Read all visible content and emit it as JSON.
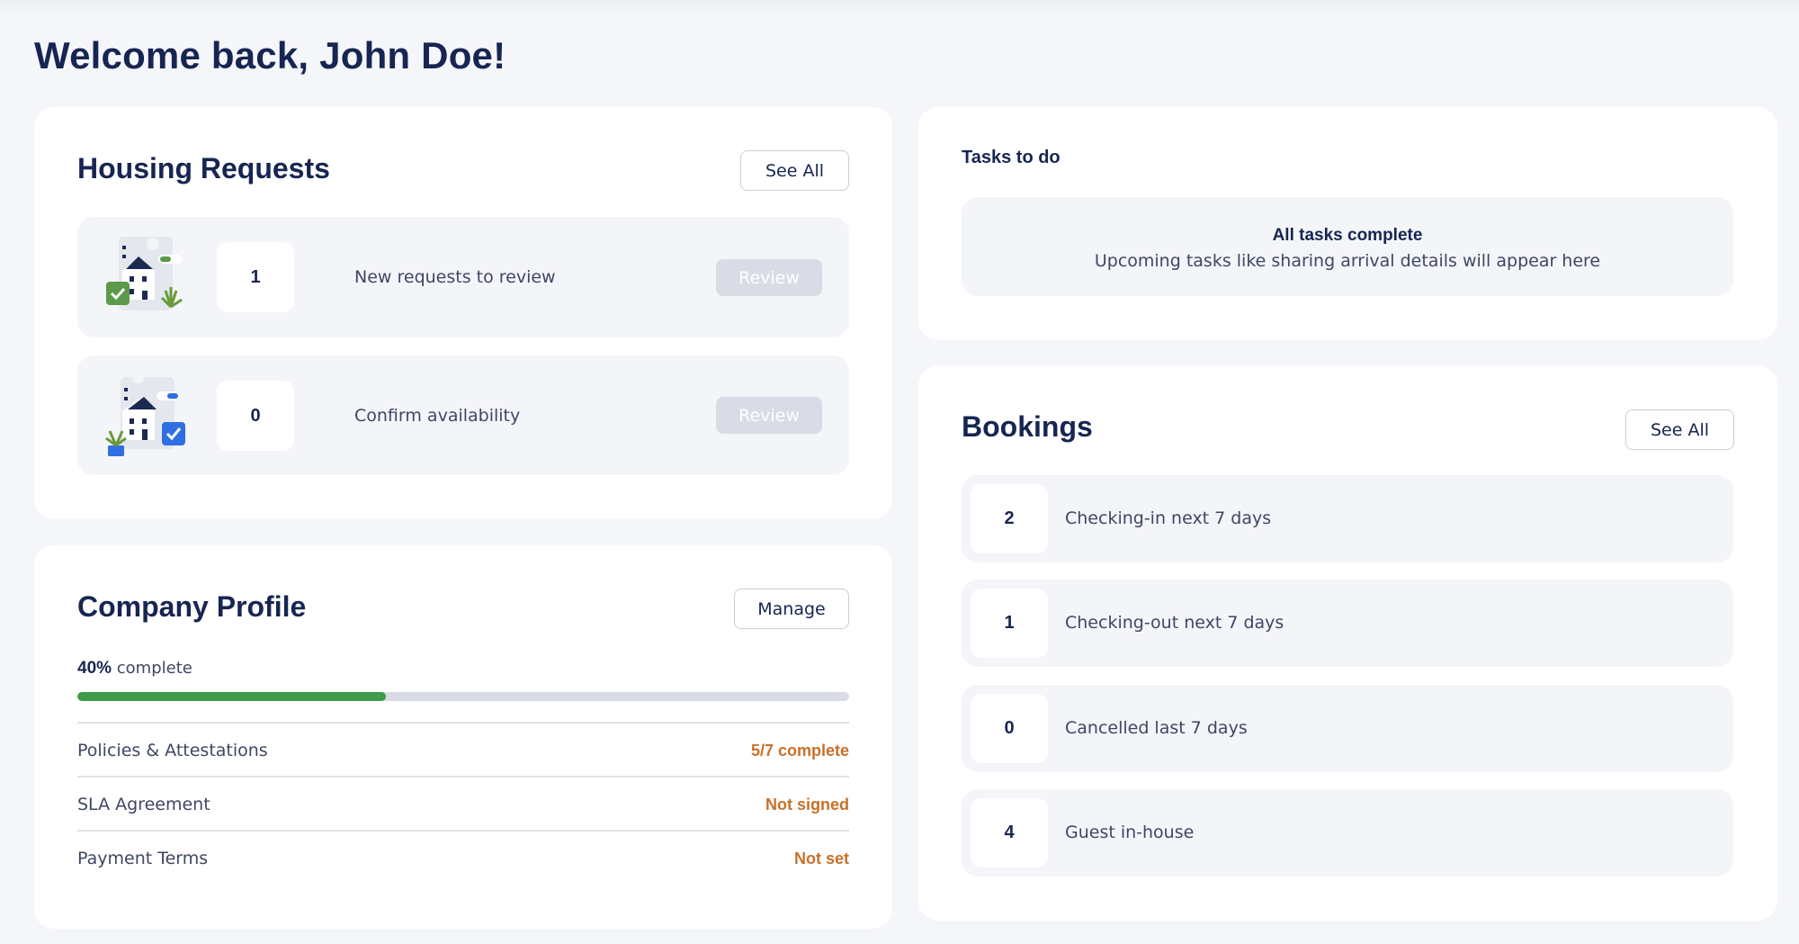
{
  "header": {
    "title": "Welcome back, John Doe!"
  },
  "housing": {
    "title": "Housing Requests",
    "see_all": "See All",
    "items": [
      {
        "count": "1",
        "label": "New requests to review",
        "action": "Review"
      },
      {
        "count": "0",
        "label": "Confirm availability",
        "action": "Review"
      }
    ]
  },
  "tasks": {
    "title": "Tasks to do",
    "empty_title": "All tasks complete",
    "empty_text": "Upcoming tasks like sharing arrival details will appear here"
  },
  "bookings": {
    "title": "Bookings",
    "see_all": "See All",
    "items": [
      {
        "count": "2",
        "label": "Checking-in next 7 days"
      },
      {
        "count": "1",
        "label": "Checking-out next 7 days"
      },
      {
        "count": "0",
        "label": "Cancelled last 7 days"
      },
      {
        "count": "4",
        "label": "Guest in-house"
      }
    ]
  },
  "profile": {
    "title": "Company Profile",
    "manage": "Manage",
    "percent_text": "40%",
    "complete_text": "complete",
    "progress_value": 40,
    "rows": [
      {
        "label": "Policies & Attestations",
        "status": "5/7 complete"
      },
      {
        "label": "SLA Agreement",
        "status": "Not signed"
      },
      {
        "label": "Payment Terms",
        "status": "Not set"
      }
    ]
  },
  "colors": {
    "primary_text": "#172552",
    "progress": "#3f9a4a",
    "warning": "#c8702a",
    "background": "#f5f6fa"
  },
  "icons": {
    "housing_new": "house-check-illustration-icon",
    "housing_confirm": "house-calendar-illustration-icon"
  }
}
